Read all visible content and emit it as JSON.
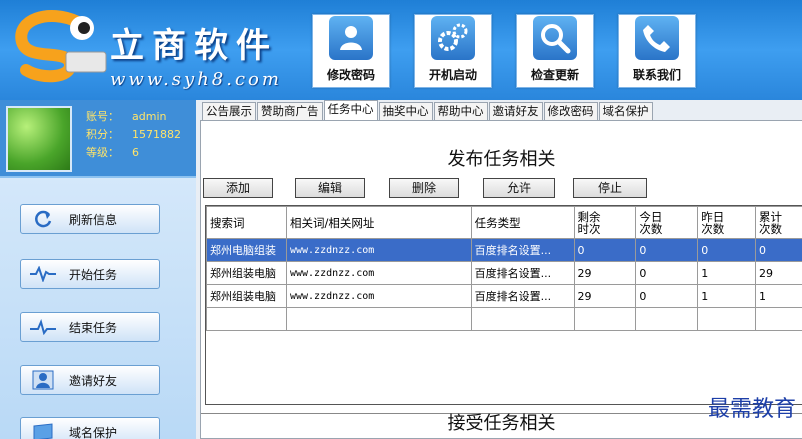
{
  "header": {
    "brand_name": "立商软件",
    "brand_url": "www.syh8.com",
    "buttons": [
      {
        "label": "修改密码",
        "icon": "person-wrench-icon"
      },
      {
        "label": "开机启动",
        "icon": "gears-icon"
      },
      {
        "label": "检查更新",
        "icon": "magnifier-icon"
      },
      {
        "label": "联系我们",
        "icon": "phone-icon"
      }
    ]
  },
  "user": {
    "account_label": "账号：",
    "account_value": "admin",
    "points_label": "积分：",
    "points_value": "1571882",
    "level_label": "等级：",
    "level_value": "6"
  },
  "sidebar": {
    "items": [
      {
        "label": "刷新信息",
        "icon": "refresh-icon"
      },
      {
        "label": "开始任务",
        "icon": "pulse-icon"
      },
      {
        "label": "结束任务",
        "icon": "heartbeat-icon"
      },
      {
        "label": "邀请好友",
        "icon": "users-icon"
      },
      {
        "label": "域名保护",
        "icon": "shield-icon"
      }
    ]
  },
  "tabs": [
    "公告展示",
    "赞助商广告",
    "任务中心",
    "抽奖中心",
    "帮助中心",
    "邀请好友",
    "修改密码",
    "域名保护"
  ],
  "active_tab": "任务中心",
  "publish": {
    "title": "发布任务相关",
    "buttons": [
      "添加",
      "编辑",
      "删除",
      "允许",
      "停止"
    ],
    "columns": [
      "搜索词",
      "相关词/相关网址",
      "任务类型",
      "剩余\n时次",
      "今日\n次数",
      "昨日\n次数",
      "累计\n次数"
    ],
    "rows": [
      [
        "郑州电脑组装",
        "www.zzdnzz.com",
        "百度排名设置...",
        "0",
        "0",
        "0",
        "0"
      ],
      [
        "郑州组装电脑",
        "www.zzdnzz.com",
        "百度排名设置...",
        "29",
        "0",
        "1",
        "29"
      ],
      [
        "郑州组装电脑",
        "www.zzdnzz.com",
        "百度排名设置...",
        "29",
        "0",
        "1",
        "1"
      ],
      [
        "",
        "",
        "",
        "",
        "",
        "",
        ""
      ]
    ]
  },
  "accept": {
    "title": "接受任务相关"
  },
  "watermark": "最需教育"
}
